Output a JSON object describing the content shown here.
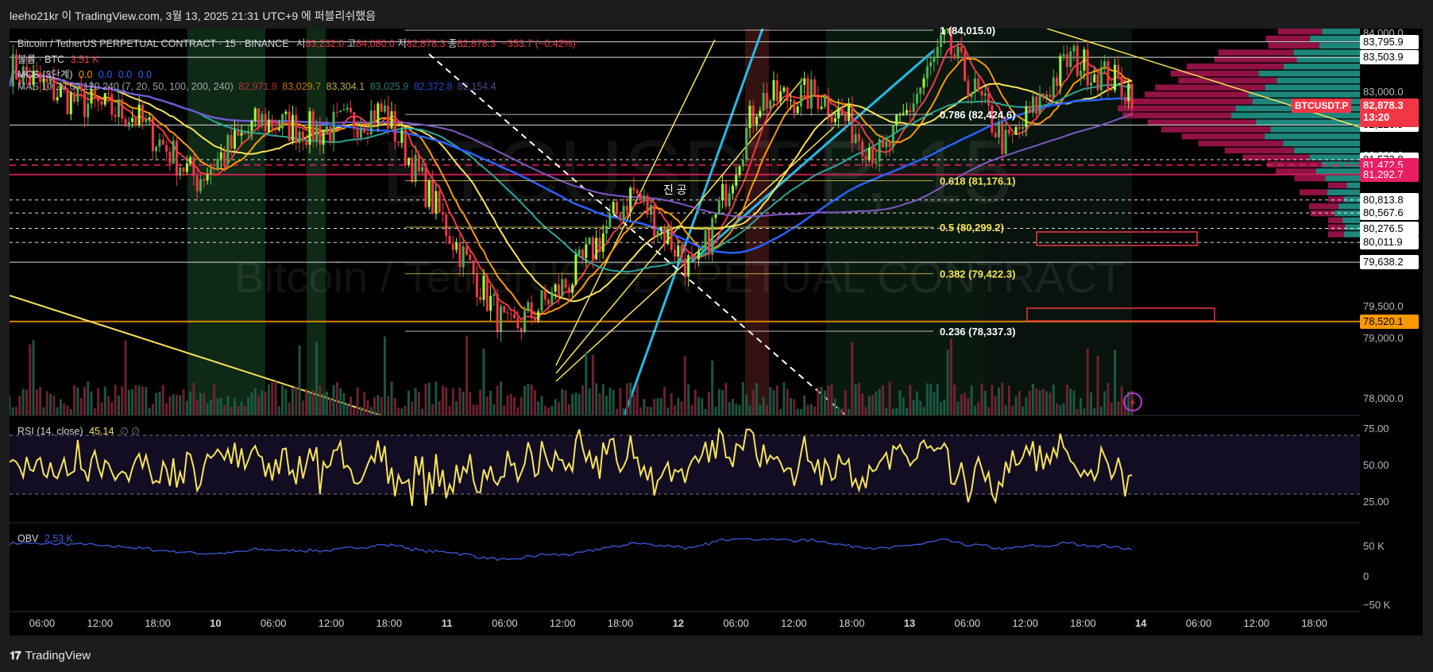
{
  "header": {
    "publish_text": "leeho21kr 이 TradingView.com, 3월 13, 2025 21:31 UTC+9 에 퍼블리쉬했음"
  },
  "legend": {
    "symbol": "Bitcoin / TetherUS PERPETUAL CONTRACT · 15 · BINANCE",
    "ohlc": {
      "o_label": "시",
      "o": "83,232.0",
      "h_label": "고",
      "h": "84,080.0",
      "l_label": "저",
      "l": "82,878.3",
      "c_label": "종",
      "c": "82,878.3",
      "change": "−353.7 (−0.42%)"
    },
    "volume": {
      "label": "볼륨 · BTC",
      "value": "3.51 K"
    },
    "mcs": {
      "label": "MCS (3단계)",
      "values": [
        "0.0",
        "0.0",
        "0.0",
        "0.0"
      ]
    },
    "mas": {
      "label": "MAS 10 20 60 120 240 (7, 20, 50, 100, 200, 240)",
      "values": [
        "82,971.8",
        "83,029.7",
        "83,304.1",
        "83,025.9",
        "82,372.8",
        "82,154.4"
      ]
    }
  },
  "watermark": {
    "big": "BTCUSDT.P, 15",
    "small": "Bitcoin / TetherUS PERPETUAL CONTRACT"
  },
  "fib_levels": [
    {
      "label": "1 (84,015.0)",
      "price": 84015.0,
      "color": "#ffffff"
    },
    {
      "label": "0.786 (82,424.6)",
      "price": 82424.6,
      "color": "#ffffff"
    },
    {
      "label": "0.618 (81,176.1)",
      "price": 81176.1,
      "color": "#f7e35a"
    },
    {
      "label": "0.5 (80,299.2)",
      "price": 80299.2,
      "color": "#f7e35a"
    },
    {
      "label": "0.382 (79,422.3)",
      "price": 79422.3,
      "color": "#f7e35a"
    },
    {
      "label": "0.236 (78,337.3)",
      "price": 78337.3,
      "color": "#ffffff"
    }
  ],
  "annotation_text": "진 공",
  "price_axis": {
    "ticks": [
      "84,000.0",
      "83,000.0",
      "82,500.0",
      "82,000.0",
      "79,500.0",
      "79,000.0",
      "78,000.0"
    ],
    "boxes": [
      {
        "label": "83,795.9",
        "price": 83795.9,
        "bg": "#ffffff",
        "fg": "#000000"
      },
      {
        "label": "83,503.9",
        "price": 83503.9,
        "bg": "#ffffff",
        "fg": "#000000"
      },
      {
        "label": "82,226.9",
        "price": 82226.9,
        "bg": "#ffffff",
        "fg": "#000000"
      },
      {
        "label": "81,573.8",
        "price": 81573.8,
        "bg": "#ffffff",
        "fg": "#000000"
      },
      {
        "label": "81,472.5",
        "price": 81472.5,
        "bg": "#e91e63",
        "fg": "#ffffff"
      },
      {
        "label": "81,292.7",
        "price": 81292.7,
        "bg": "#e91e63",
        "fg": "#ffffff"
      },
      {
        "label": "80,813.8",
        "price": 80813.8,
        "bg": "#ffffff",
        "fg": "#000000"
      },
      {
        "label": "80,567.6",
        "price": 80567.6,
        "bg": "#ffffff",
        "fg": "#000000"
      },
      {
        "label": "80,276.5",
        "price": 80276.5,
        "bg": "#ffffff",
        "fg": "#000000"
      },
      {
        "label": "80,011.9",
        "price": 80011.9,
        "bg": "#ffffff",
        "fg": "#000000"
      },
      {
        "label": "79,638.2",
        "price": 79638.2,
        "bg": "#ffffff",
        "fg": "#000000"
      },
      {
        "label": "78,520.1",
        "price": 78520.1,
        "bg": "#ff9800",
        "fg": "#000000"
      }
    ],
    "current": {
      "symbol": "BTCUSDT.P",
      "price": "82,878.3",
      "countdown": "13:20",
      "color": "#f23645"
    }
  },
  "rsi": {
    "label": "RSI (14, close)",
    "value": "45.14",
    "extra": "∅ ∅",
    "ticks": [
      "75.00",
      "50.00",
      "25.00"
    ]
  },
  "obv": {
    "label": "OBV",
    "value": "2.53 K",
    "ticks": [
      "50 K",
      "0",
      "−50 K"
    ]
  },
  "time_axis": [
    "06:00",
    "12:00",
    "18:00",
    "10",
    "06:00",
    "12:00",
    "18:00",
    "11",
    "06:00",
    "12:00",
    "18:00",
    "12",
    "06:00",
    "12:00",
    "18:00",
    "13",
    "06:00",
    "12:00",
    "18:00",
    "14",
    "06:00",
    "12:00",
    "18:00"
  ],
  "footer": {
    "brand": "TradingView"
  },
  "colors": {
    "bull": "#4caf50",
    "bull_bright": "#9bff3a",
    "bear": "#f23645",
    "rsi": "#f7e35a",
    "obv": "#3a5bdc",
    "ma_yellow": "#f7e35a",
    "ma_orange": "#ff9800",
    "ma_green": "#26a69a",
    "ma_blue": "#2962ff",
    "ma_purple": "#7e57c2",
    "trend_cyan": "#22bbe6"
  },
  "chart_data": {
    "type": "line",
    "title": "Bitcoin / TetherUS PERPETUAL CONTRACT · 15 · BINANCE",
    "x": [
      "06:00",
      "12:00",
      "18:00",
      "10",
      "06:00",
      "12:00",
      "18:00",
      "11",
      "06:00",
      "12:00",
      "18:00",
      "12",
      "06:00",
      "12:00",
      "18:00",
      "13",
      "06:00",
      "12:00",
      "18:00"
    ],
    "series": [
      {
        "name": "",
        "values": [
          83300,
          82700,
          82400,
          81200,
          82300,
          82100,
          82500,
          80300,
          78300,
          79300,
          81000,
          79400,
          82700,
          82800,
          81600,
          83800,
          81800,
          83500,
          82878
        ]
      }
    ],
    "ylim": [
      77700,
      84200
    ],
    "grid": false,
    "legend": "top-left"
  }
}
